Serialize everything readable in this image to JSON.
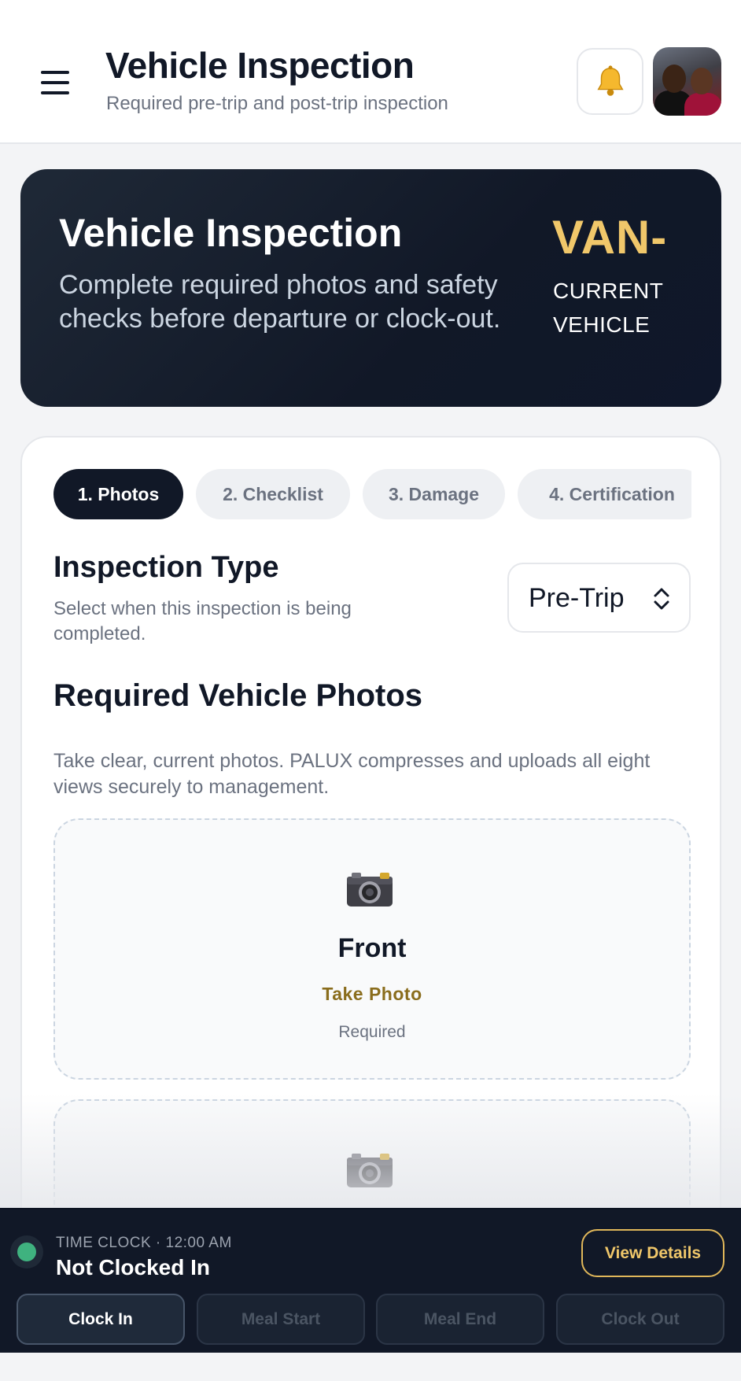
{
  "header": {
    "title": "Vehicle Inspection",
    "subtitle": "Required pre-trip and post-trip inspection",
    "menu_icon": "hamburger-menu-icon",
    "notification_icon": "bell-icon"
  },
  "hero": {
    "title": "Vehicle Inspection",
    "description": "Complete required photos and safety checks before departure or clock-out.",
    "vehicle_code": "VAN-",
    "vehicle_label": "CURRENT VEHICLE"
  },
  "tabs": [
    {
      "label": "1. Photos",
      "active": true
    },
    {
      "label": "2. Checklist",
      "active": false
    },
    {
      "label": "3. Damage",
      "active": false
    },
    {
      "label": "4. Certification",
      "active": false
    }
  ],
  "inspection_type": {
    "title": "Inspection Type",
    "description": "Select when this inspection is being completed.",
    "selected": "Pre-Trip"
  },
  "photos": {
    "title": "Required Vehicle Photos",
    "description": "Take clear, current photos. PALUX compresses and uploads all eight views securely to management.",
    "slots": [
      {
        "name": "Front",
        "action": "Take Photo",
        "status": "Required",
        "icon": "camera-icon"
      },
      {
        "name": "",
        "action": "",
        "status": "",
        "icon": "camera-icon"
      }
    ]
  },
  "time_clock": {
    "kicker": "TIME CLOCK · 12:00 AM",
    "status": "Not Clocked In",
    "view_details": "View Details",
    "buttons": [
      "Clock In",
      "Meal Start",
      "Meal End",
      "Clock Out"
    ]
  },
  "colors": {
    "accent_gold": "#f0c76a",
    "dark_navy": "#111827",
    "status_green": "#3fb27f"
  }
}
